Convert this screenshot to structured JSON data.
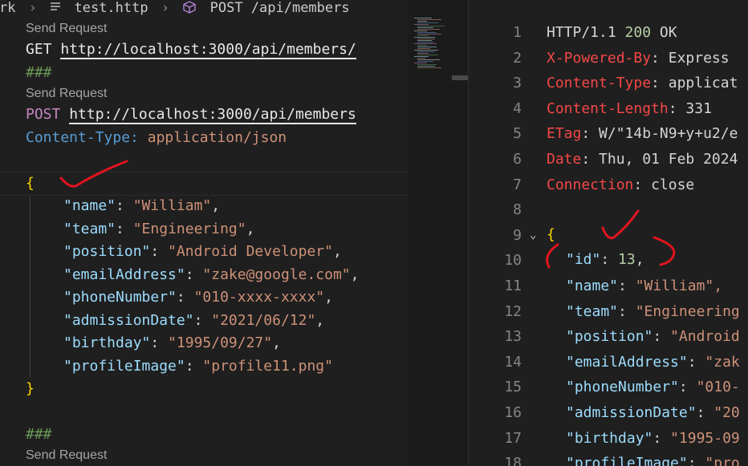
{
  "breadcrumb": {
    "prefix": "rk",
    "file": "test.http",
    "request": "POST /api/members"
  },
  "request_file": {
    "codelens_label": "Send Request",
    "get_method": "GET",
    "get_url": "http://localhost:3000/api/members/",
    "separator": "###",
    "post_method": "POST",
    "post_url": "http://localhost:3000/api/members",
    "header_key": "Content-Type:",
    "header_value": "application/json",
    "open_brace": "{",
    "close_brace": "}",
    "body": [
      {
        "key": "\"name\"",
        "value": "\"William\"",
        "comma": ","
      },
      {
        "key": "\"team\"",
        "value": "\"Engineering\"",
        "comma": ","
      },
      {
        "key": "\"position\"",
        "value": "\"Android Developer\"",
        "comma": ","
      },
      {
        "key": "\"emailAddress\"",
        "value": "\"zake@google.com\"",
        "comma": ","
      },
      {
        "key": "\"phoneNumber\"",
        "value": "\"010-xxxx-xxxx\"",
        "comma": ","
      },
      {
        "key": "\"admissionDate\"",
        "value": "\"2021/06/12\"",
        "comma": ","
      },
      {
        "key": "\"birthday\"",
        "value": "\"1995/09/27\"",
        "comma": ","
      },
      {
        "key": "\"profileImage\"",
        "value": "\"profile11.png\"",
        "comma": ""
      }
    ],
    "separator2": "###",
    "codelens_label3": "Send Request"
  },
  "response": {
    "line_numbers": [
      "1",
      "2",
      "3",
      "4",
      "5",
      "6",
      "7",
      "8",
      "9",
      "10",
      "11",
      "12",
      "13",
      "14",
      "15",
      "16",
      "17",
      "18"
    ],
    "status_proto": "HTTP/1.1",
    "status_code": "200",
    "status_text": "OK",
    "headers": [
      {
        "key": "X-Powered-By",
        "value": "Express"
      },
      {
        "key": "Content-Type",
        "value": "applicat"
      },
      {
        "key": "Content-Length",
        "value": "331"
      },
      {
        "key": "ETag",
        "value": "W/\"14b-N9+y+u2/e"
      },
      {
        "key": "Date",
        "value": "Thu, 01 Feb 2024"
      },
      {
        "key": "Connection",
        "value": "close"
      }
    ],
    "open_brace": "{",
    "id_key": "\"id\"",
    "id_value": "13",
    "body": [
      {
        "key": "\"name\"",
        "value": "\"William\","
      },
      {
        "key": "\"team\"",
        "value": "\"Engineering"
      },
      {
        "key": "\"position\"",
        "value": "\"Android"
      },
      {
        "key": "\"emailAddress\"",
        "value": "\"zak"
      },
      {
        "key": "\"phoneNumber\"",
        "value": "\"010-"
      },
      {
        "key": "\"admissionDate\"",
        "value": "\"20"
      },
      {
        "key": "\"birthday\"",
        "value": "\"1995-09"
      },
      {
        "key": "\"profileImage\"",
        "value": "\"pro"
      }
    ]
  },
  "colors": {
    "background": "#1f1f1f",
    "annotation_red": "#e0141e",
    "json_key": "#9cdcfe",
    "json_string": "#ce9178",
    "header_key_response": "#f44747"
  }
}
